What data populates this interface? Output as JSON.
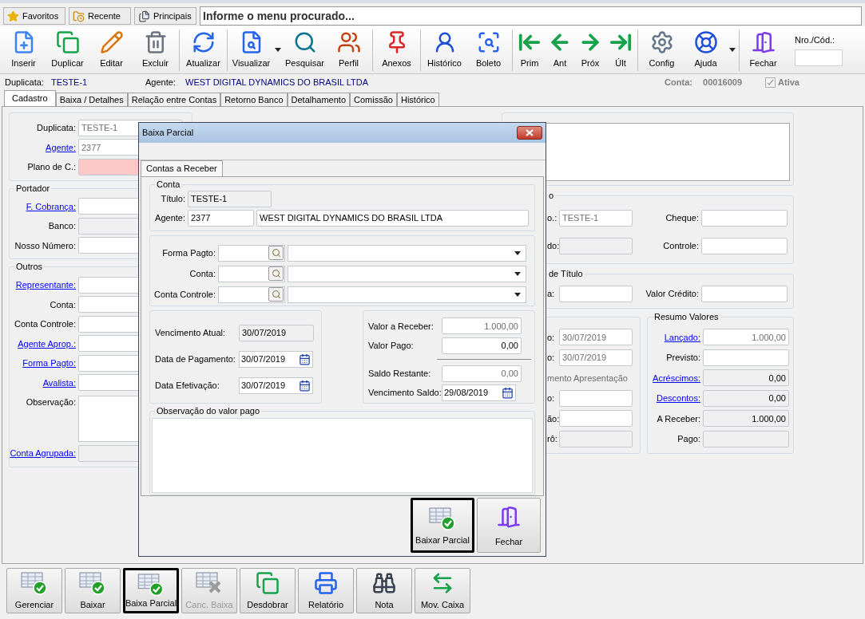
{
  "menu_bar": {
    "shortcuts": [
      {
        "label": "Favoritos"
      },
      {
        "label": "Recente"
      },
      {
        "label": "Principais"
      }
    ],
    "search": {
      "placeholder": "Informe o menu procurado..."
    }
  },
  "toolbar": {
    "groups": [
      [
        {
          "label": "Inserir",
          "menu": false
        },
        {
          "label": "Duplicar",
          "menu": false
        },
        {
          "label": "Editar",
          "menu": false
        },
        {
          "label": "Excluir",
          "menu": false
        }
      ],
      [
        {
          "label": "Atualizar",
          "menu": false
        }
      ],
      [
        {
          "label": "Visualizar",
          "menu": true
        },
        {
          "label": "Pesquisar",
          "menu": false
        },
        {
          "label": "Perfil",
          "menu": false
        }
      ],
      [
        {
          "label": "Anexos",
          "menu": false
        }
      ],
      [
        {
          "label": "Histórico",
          "menu": false
        },
        {
          "label": "Boleto",
          "menu": false
        }
      ],
      [
        {
          "label": "Prim",
          "menu": false
        },
        {
          "label": "Ant",
          "menu": false
        },
        {
          "label": "Próx",
          "menu": false
        },
        {
          "label": "Últ",
          "menu": false
        }
      ],
      [
        {
          "label": "Config",
          "menu": false
        },
        {
          "label": "Ajuda",
          "menu": true
        }
      ],
      [
        {
          "label": "Fechar",
          "menu": false
        }
      ]
    ],
    "code_field": {
      "label": "Nro./Cód.:"
    }
  },
  "header": {
    "duplicata_label": "Duplicata:",
    "duplicata": "TESTE-1",
    "agente_label": "Agente:",
    "agente": "WEST DIGITAL DYNAMICS DO BRASIL LTDA",
    "conta_label": "Conta:",
    "conta": "00016009",
    "ativa": {
      "label": "Ativa",
      "checked": true,
      "disabled": true
    }
  },
  "tabs": [
    {
      "label": "Cadastro",
      "selected": true
    },
    {
      "label": "Baixa / Detalhes",
      "selected": false
    },
    {
      "label": "Relação entre Contas",
      "selected": false
    },
    {
      "label": "Retorno Banco",
      "selected": false
    },
    {
      "label": "Detalhamento",
      "selected": false
    },
    {
      "label": "Comissão",
      "selected": false
    },
    {
      "label": "Histórico",
      "selected": false
    }
  ],
  "left_form": {
    "groups": [
      {
        "rows": [
          {
            "label": "Duplicata:",
            "link": false,
            "value": "TESTE-1",
            "kind": "disabled"
          },
          {
            "label": "Agente:",
            "link": true,
            "value": "2377",
            "kind": "disabled"
          },
          {
            "label": "Plano de C.:",
            "link": false,
            "kind": "required"
          }
        ]
      },
      {
        "legend": "Portador",
        "rows": [
          {
            "label": "F. Cobrança:",
            "link": true,
            "kind": "text"
          },
          {
            "label": "Banco:",
            "link": false,
            "kind": "readonly"
          },
          {
            "label": "Nosso Número:",
            "link": false,
            "kind": "text"
          }
        ]
      },
      {
        "legend": "Outros",
        "rows": [
          {
            "label": "Representante:",
            "link": true,
            "kind": "text"
          },
          {
            "label": "Conta:",
            "link": false,
            "kind": "text"
          },
          {
            "label": "Conta Controle:",
            "link": false,
            "kind": "text"
          },
          {
            "label": "Agente Aprop.:",
            "link": true,
            "kind": "text"
          },
          {
            "label": "Forma Pagto:",
            "link": true,
            "kind": "text"
          },
          {
            "label": "Avalista:",
            "link": true,
            "kind": "text"
          },
          {
            "label": "Observação:",
            "link": false,
            "kind": "textarea"
          },
          {
            "label": "Conta Agrupada:",
            "link": true,
            "kind": "readonly"
          }
        ]
      }
    ]
  },
  "right_form": {
    "groups": [
      {
        "legend": "o",
        "rows": [
          [
            {
              "label": "o.:",
              "value": "TESTE-1",
              "kind": "disabled"
            },
            {
              "label": "Cheque:",
              "kind": "text"
            }
          ],
          [
            {
              "label": "do:",
              "kind": "readonly"
            },
            {
              "label": "Controle:",
              "kind": "text"
            }
          ]
        ]
      },
      {
        "legend": "de Título",
        "rows": [
          [
            {
              "label": "a:",
              "kind": "text"
            },
            {
              "label": "Valor Crédito:",
              "kind": "text"
            }
          ]
        ]
      }
    ],
    "dates_group": {
      "items": [
        {
          "label": "o:",
          "value": "30/07/2019",
          "kind": "disabled"
        },
        {
          "label": "o:",
          "value": "30/07/2019",
          "kind": "disabled"
        },
        {
          "label": "mento Apresentação",
          "kind": "caption"
        },
        {
          "label": "o:",
          "kind": "text"
        },
        {
          "label": "ão:",
          "kind": "text"
        },
        {
          "label": "rô:",
          "kind": "readonly"
        }
      ]
    },
    "summary": {
      "legend": "Resumo Valores",
      "items": [
        {
          "label": "Lançado:",
          "link": true,
          "value": "1.000,00",
          "kind": "disabled"
        },
        {
          "label": "Previsto:",
          "link": false,
          "kind": "text"
        },
        {
          "label": "Acréscimos:",
          "link": true,
          "value": "0,00",
          "kind": "readonly"
        },
        {
          "label": "Descontos:",
          "link": true,
          "value": "0,00",
          "kind": "readonly"
        },
        {
          "label": "A Receber:",
          "link": false,
          "value": "1.000,00",
          "kind": "readonly"
        },
        {
          "label": "Pago:",
          "link": false,
          "kind": "readonly"
        }
      ]
    }
  },
  "dialog": {
    "title": "Baixa Parcial",
    "tabs": [
      {
        "label": "Contas a Receber",
        "selected": true
      }
    ],
    "conta_group": {
      "legend": "Conta",
      "titulo": {
        "label": "Título:",
        "value": "TESTE-1"
      },
      "agente": {
        "label": "Agente:",
        "code": "2377",
        "name": "WEST DIGITAL DYNAMICS DO BRASIL LTDA"
      }
    },
    "lookups": [
      {
        "label": "Forma Pagto:"
      },
      {
        "label": "Conta:"
      },
      {
        "label": "Conta Controle:"
      }
    ],
    "dates": [
      {
        "label": "Vencimento Atual:",
        "value": "30/07/2019",
        "kind": "readonly"
      },
      {
        "label": "Data de Pagamento:",
        "value": "30/07/2019",
        "kind": "date"
      },
      {
        "label": "Data Efetivação:",
        "value": "30/07/2019",
        "kind": "date"
      }
    ],
    "values": [
      {
        "label": "Valor a Receber:",
        "value": "1.000,00",
        "kind": "disabled"
      },
      {
        "label": "Valor Pago:",
        "value": "0,00",
        "kind": "text"
      },
      {
        "kind": "separator"
      },
      {
        "label": "Saldo Restante:",
        "value": "0,00",
        "kind": "disabled"
      },
      {
        "label": "Vencimento Saldo:",
        "value": "29/08/2019",
        "kind": "date"
      }
    ],
    "observation": {
      "legend": "Observação do valor pago"
    },
    "buttons": [
      {
        "label": "Baixar Parcial",
        "selected": true
      },
      {
        "label": "Fechar",
        "selected": false
      }
    ]
  },
  "bottom_buttons": [
    {
      "label": "Gerenciar",
      "disabled": false,
      "selected": false
    },
    {
      "label": "Baixar",
      "disabled": false,
      "selected": false
    },
    {
      "label": "Baixa Parcial",
      "disabled": false,
      "selected": true
    },
    {
      "label": "Canc. Baixa",
      "disabled": true,
      "selected": false
    },
    {
      "label": "Desdobrar",
      "disabled": false,
      "selected": false
    },
    {
      "label": "Relatório",
      "disabled": false,
      "selected": false
    },
    {
      "label": "Nota",
      "disabled": false,
      "selected": false
    },
    {
      "label": "Mov. Caixa",
      "disabled": false,
      "selected": false
    }
  ]
}
